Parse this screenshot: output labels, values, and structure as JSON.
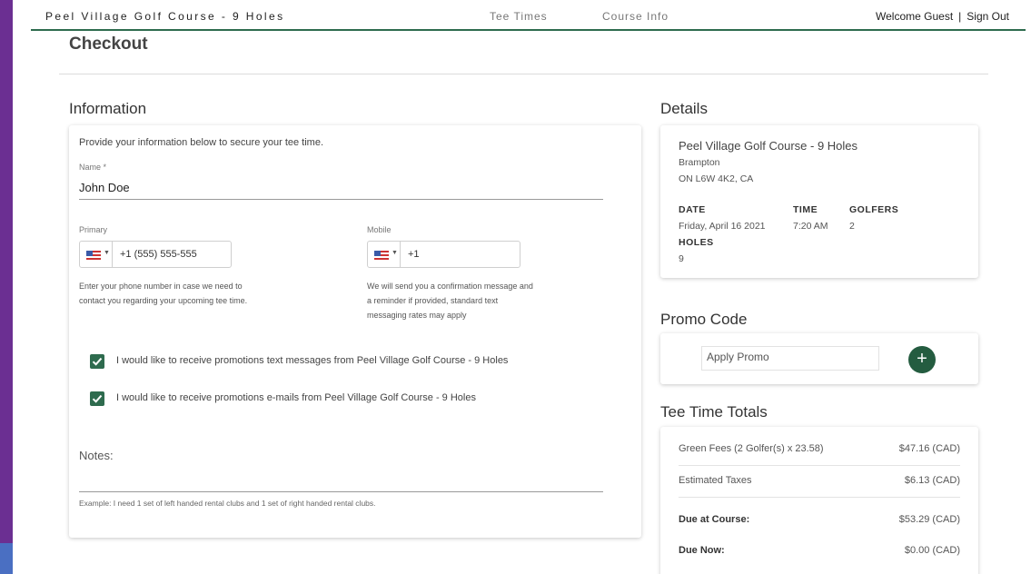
{
  "header": {
    "brand": "Peel Village Golf Course - 9 Holes",
    "nav": [
      "Tee Times",
      "Course Info"
    ],
    "welcome": "Welcome Guest",
    "separator": "|",
    "sign_out": "Sign Out"
  },
  "page_title": "Checkout",
  "information": {
    "heading": "Information",
    "intro": "Provide your information below to secure your tee time.",
    "name_label": "Name *",
    "name_value": "John Doe",
    "primary": {
      "label": "Primary",
      "value": "+1 (555) 555-555",
      "helper": "Enter your phone number in case we need to contact you regarding your upcoming tee time."
    },
    "mobile": {
      "label": "Mobile",
      "value": "+1",
      "helper": "We will send you a confirmation message and a reminder if provided, standard text messaging rates may apply"
    },
    "promo_text_checkbox": "I would like to receive promotions text messages from Peel Village Golf Course - 9 Holes",
    "promo_email_checkbox": "I would like to receive promotions e-mails from Peel Village Golf Course - 9 Holes",
    "notes_label": "Notes:",
    "notes_example": "Example: I need 1 set of left handed rental clubs and 1 set of right handed rental clubs."
  },
  "details": {
    "heading": "Details",
    "course": "Peel Village Golf Course - 9 Holes",
    "city": "Brampton",
    "province": "ON L6W 4K2, CA",
    "date_label": "DATE",
    "date_value": "Friday, April 16 2021",
    "time_label": "TIME",
    "time_value": "7:20 AM",
    "golfers_label": "GOLFERS",
    "golfers_value": "2",
    "holes_label": "HOLES",
    "holes_value": "9"
  },
  "promo": {
    "heading": "Promo Code",
    "placeholder": "Apply Promo",
    "add_symbol": "+"
  },
  "totals": {
    "heading": "Tee Time Totals",
    "rows": [
      {
        "label": "Green Fees (2 Golfer(s) x 23.58)",
        "value": "$47.16 (CAD)"
      },
      {
        "label": "Estimated Taxes",
        "value": "$6.13 (CAD)"
      },
      {
        "label": "Due at Course:",
        "value": "$53.29 (CAD)"
      },
      {
        "label": "Due Now:",
        "value": "$0.00 (CAD)"
      }
    ]
  },
  "colors": {
    "accent_green": "#2e6b4e",
    "side_stripe": "#6b2f92"
  }
}
